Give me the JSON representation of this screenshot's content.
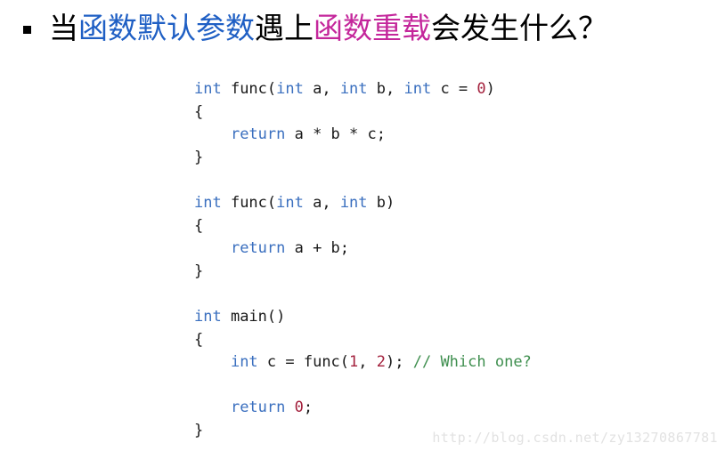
{
  "slide": {
    "bullet_icon": "square-bullet-icon",
    "title": {
      "segments": [
        {
          "text": "当",
          "color": "#000000",
          "style": "plain"
        },
        {
          "text": "函数默认参数",
          "color": "#1f5fc4",
          "style": "blue"
        },
        {
          "text": "遇上",
          "color": "#000000",
          "style": "plain"
        },
        {
          "text": "函数重载",
          "color": "#c4269b",
          "style": "magenta"
        },
        {
          "text": "会发生什么？",
          "color": "#000000",
          "style": "plain"
        }
      ],
      "full_text": "当函数默认参数遇上函数重载会发生什么？"
    }
  },
  "code": {
    "language": "cpp",
    "colors": {
      "keyword": "#3a6fbf",
      "number": "#a3203c",
      "comment": "#3f8f4f",
      "default": "#1a1a1a"
    },
    "lines": [
      {
        "index": 1,
        "tokens": [
          {
            "t": "int",
            "c": "kw"
          },
          {
            "t": " func(",
            "c": "pun"
          },
          {
            "t": "int",
            "c": "kw"
          },
          {
            "t": " a, ",
            "c": "pun"
          },
          {
            "t": "int",
            "c": "kw"
          },
          {
            "t": " b, ",
            "c": "pun"
          },
          {
            "t": "int",
            "c": "kw"
          },
          {
            "t": " c = ",
            "c": "pun"
          },
          {
            "t": "0",
            "c": "num"
          },
          {
            "t": ")",
            "c": "pun"
          }
        ],
        "plain": "int func(int a, int b, int c = 0)"
      },
      {
        "index": 2,
        "tokens": [
          {
            "t": "{",
            "c": "pun"
          }
        ],
        "plain": "{"
      },
      {
        "index": 3,
        "tokens": [
          {
            "t": "    ",
            "c": "pun"
          },
          {
            "t": "return",
            "c": "kw"
          },
          {
            "t": " a * b * c;",
            "c": "pun"
          }
        ],
        "plain": "    return a * b * c;"
      },
      {
        "index": 4,
        "tokens": [
          {
            "t": "}",
            "c": "pun"
          }
        ],
        "plain": "}"
      },
      {
        "index": 5,
        "tokens": [],
        "plain": ""
      },
      {
        "index": 6,
        "tokens": [
          {
            "t": "int",
            "c": "kw"
          },
          {
            "t": " func(",
            "c": "pun"
          },
          {
            "t": "int",
            "c": "kw"
          },
          {
            "t": " a, ",
            "c": "pun"
          },
          {
            "t": "int",
            "c": "kw"
          },
          {
            "t": " b)",
            "c": "pun"
          }
        ],
        "plain": "int func(int a, int b)"
      },
      {
        "index": 7,
        "tokens": [
          {
            "t": "{",
            "c": "pun"
          }
        ],
        "plain": "{"
      },
      {
        "index": 8,
        "tokens": [
          {
            "t": "    ",
            "c": "pun"
          },
          {
            "t": "return",
            "c": "kw"
          },
          {
            "t": " a + b;",
            "c": "pun"
          }
        ],
        "plain": "    return a + b;"
      },
      {
        "index": 9,
        "tokens": [
          {
            "t": "}",
            "c": "pun"
          }
        ],
        "plain": "}"
      },
      {
        "index": 10,
        "tokens": [],
        "plain": ""
      },
      {
        "index": 11,
        "tokens": [
          {
            "t": "int",
            "c": "kw"
          },
          {
            "t": " main()",
            "c": "pun"
          }
        ],
        "plain": "int main()"
      },
      {
        "index": 12,
        "tokens": [
          {
            "t": "{",
            "c": "pun"
          }
        ],
        "plain": "{"
      },
      {
        "index": 13,
        "tokens": [
          {
            "t": "    ",
            "c": "pun"
          },
          {
            "t": "int",
            "c": "kw"
          },
          {
            "t": " c = func(",
            "c": "pun"
          },
          {
            "t": "1",
            "c": "num"
          },
          {
            "t": ", ",
            "c": "pun"
          },
          {
            "t": "2",
            "c": "num"
          },
          {
            "t": "); ",
            "c": "pun"
          },
          {
            "t": "// Which one?",
            "c": "cmt"
          }
        ],
        "plain": "    int c = func(1, 2); // Which one?"
      },
      {
        "index": 14,
        "tokens": [],
        "plain": ""
      },
      {
        "index": 15,
        "tokens": [
          {
            "t": "    ",
            "c": "pun"
          },
          {
            "t": "return",
            "c": "kw"
          },
          {
            "t": " ",
            "c": "pun"
          },
          {
            "t": "0",
            "c": "num"
          },
          {
            "t": ";",
            "c": "pun"
          }
        ],
        "plain": "    return 0;"
      },
      {
        "index": 16,
        "tokens": [
          {
            "t": "}",
            "c": "pun"
          }
        ],
        "plain": "}"
      }
    ]
  },
  "watermark": {
    "text": "http://blog.csdn.net/zy13270867781",
    "color": "#e2e2e2"
  }
}
